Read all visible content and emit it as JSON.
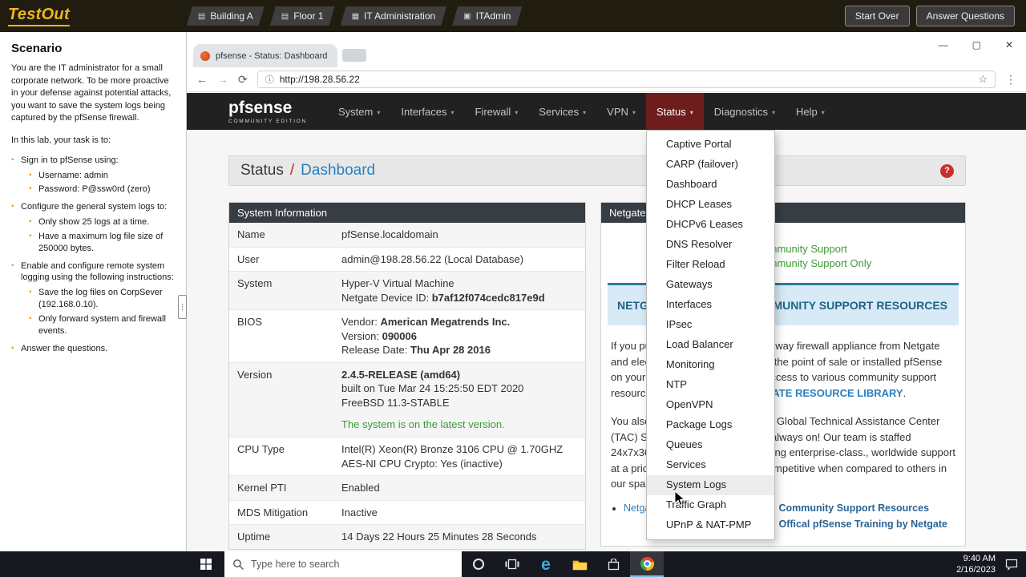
{
  "testout": {
    "logo": "TestOut",
    "breadcrumbs": [
      {
        "label": "Building A",
        "icon": "layers-icon",
        "glyph": "▤"
      },
      {
        "label": "Floor 1",
        "icon": "layers-icon",
        "glyph": "▤"
      },
      {
        "label": "IT Administration",
        "icon": "building-icon",
        "glyph": "▦"
      },
      {
        "label": "ITAdmin",
        "icon": "monitor-icon",
        "glyph": "▣"
      }
    ],
    "buttons": [
      "Start Over",
      "Answer Questions"
    ]
  },
  "scenario": {
    "title": "Scenario",
    "intro": "You are the IT administrator for a small corporate network. To be more proactive in your defense against potential attacks, you want to save the system logs being captured by the pfSense firewall.",
    "task_intro": "In this lab, your task is to:",
    "tasks": [
      {
        "text": "Sign in to pfSense using:",
        "subtasks": [
          "Username: admin",
          "Password: P@ssw0rd (zero)"
        ]
      },
      {
        "text": "Configure the general system logs to:",
        "subtasks": [
          "Only show 25 logs at a time.",
          "Have a maximum log file size of 250000 bytes."
        ]
      },
      {
        "text": "Enable and configure remote system logging using the following instructions:",
        "subtasks": [
          "Save the log files on CorpSever (192.168.0.10).",
          "Only forward system and firewall events."
        ]
      },
      {
        "text": "Answer the questions.",
        "subtasks": []
      }
    ]
  },
  "browser": {
    "tab_title": "pfsense - Status: Dashboard",
    "url": "http://198.28.56.22",
    "minimize": "—",
    "maximize": "▢",
    "close": "✕",
    "back": "←",
    "forward": "→",
    "reload": "⟳",
    "info": "ⓘ",
    "star": "☆",
    "menu": "⋮"
  },
  "pfsense": {
    "logo_main": "pfsense",
    "logo_sub": "COMMUNITY EDITION",
    "nav": [
      "System",
      "Interfaces",
      "Firewall",
      "Services",
      "VPN",
      "Status",
      "Diagnostics",
      "Help"
    ],
    "active_nav": "Status",
    "status_menu": [
      "Captive Portal",
      "CARP (failover)",
      "Dashboard",
      "DHCP Leases",
      "DHCPv6 Leases",
      "DNS Resolver",
      "Filter Reload",
      "Gateways",
      "Interfaces",
      "IPsec",
      "Load Balancer",
      "Monitoring",
      "NTP",
      "OpenVPN",
      "Package Logs",
      "Queues",
      "Services",
      "System Logs",
      "Traffic Graph",
      "UPnP & NAT-PMP"
    ],
    "highlighted_menu_item": "System Logs",
    "breadcrumb": {
      "section": "Status",
      "separator": "/",
      "page": "Dashboard",
      "help": "?"
    },
    "system_info": {
      "title": "System Information",
      "rows": [
        {
          "label": "Name",
          "lines": [
            [
              {
                "t": "pfSense.localdomain"
              }
            ]
          ]
        },
        {
          "label": "User",
          "lines": [
            [
              {
                "t": "admin@198.28.56.22 (Local Database)"
              }
            ]
          ]
        },
        {
          "label": "System",
          "lines": [
            [
              {
                "t": "Hyper-V Virtual Machine"
              }
            ],
            [
              {
                "t": "Netgate Device ID: "
              },
              {
                "t": "b7af12f074cedc817e9d",
                "b": true
              }
            ]
          ]
        },
        {
          "label": "BIOS",
          "lines": [
            [
              {
                "t": "Vendor: "
              },
              {
                "t": "American Megatrends Inc.",
                "b": true
              }
            ],
            [
              {
                "t": "Version: "
              },
              {
                "t": "090006",
                "b": true
              }
            ],
            [
              {
                "t": "Release Date: "
              },
              {
                "t": "Thu Apr 28 2016",
                "b": true
              }
            ]
          ]
        },
        {
          "label": "Version",
          "lines": [
            [
              {
                "t": "2.4.5-RELEASE (amd64)",
                "b": true
              }
            ],
            [
              {
                "t": "built on Tue Mar 24 15:25:50 EDT 2020"
              }
            ],
            [
              {
                "t": "FreeBSD 11.3-STABLE"
              }
            ],
            [
              {
                "t": "The system is on the latest version.",
                "c": "green",
                "mt": true
              }
            ]
          ]
        },
        {
          "label": "CPU Type",
          "lines": [
            [
              {
                "t": "Intel(R) Xeon(R) Bronze 3106 CPU @ 1.70GHZ"
              }
            ],
            [
              {
                "t": "AES-NI CPU Crypto: Yes (inactive)"
              }
            ]
          ]
        },
        {
          "label": "Kernel PTI",
          "lines": [
            [
              {
                "t": "Enabled"
              }
            ]
          ]
        },
        {
          "label": "MDS Mitigation",
          "lines": [
            [
              {
                "t": "Inactive"
              }
            ]
          ]
        },
        {
          "label": "Uptime",
          "lines": [
            [
              {
                "t": "14 Days 22 Hours 25 Minutes 28 Seconds"
              }
            ]
          ]
        }
      ]
    },
    "support": {
      "title": "Netgate Services and Support",
      "contract_lines": [
        "Community Support",
        "Community Support Only"
      ],
      "banner": "NETGATE AND pfSense COMMUNITY SUPPORT RESOURCES",
      "para1_pre": "If you purchased your pfSense gateway firewall appliance from Netgate and elected Community Support at the point of sale or installed pfSense on your own hardware, you have access to various community support resources. This includes the ",
      "para1_link": "NETGATE RESOURCE LIBRARY",
      "para1_post": ".",
      "para2": "You also may upgrade to a Netgate Global Technical Assistance Center (TAC) Support subscription. We're always on! Our team is staffed 24x7x365 and committed to delivering enterprise-class., worldwide support at a price point that is more than competitive when compared to others in our space.",
      "links_left": [
        "Netgate Global Support FAQ"
      ],
      "links_right": [
        "Community Support Resources",
        "Offical pfSense Training by Netgate"
      ]
    }
  },
  "taskbar": {
    "search_placeholder": "Type here to search",
    "time": "9:40 AM",
    "date": "2/16/2023"
  }
}
